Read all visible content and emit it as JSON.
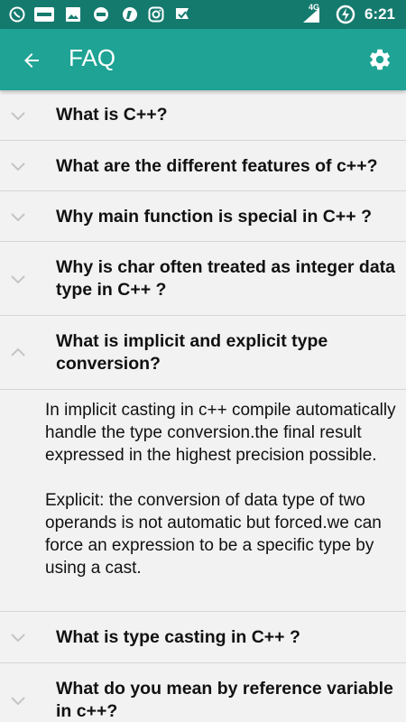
{
  "status_bar": {
    "left_icons": [
      "whatsapp-icon",
      "paytm-icon",
      "image-icon",
      "jio-icon",
      "app-icon",
      "instagram-icon",
      "checklist-icon"
    ],
    "network": "4G",
    "time": "6:21"
  },
  "app_bar": {
    "back_icon": "arrow-left-icon",
    "title": "FAQ",
    "settings_icon": "gear-icon"
  },
  "faq": [
    {
      "question": "What is C++?",
      "expanded": false
    },
    {
      "question": "What are the different features of c++?",
      "expanded": false
    },
    {
      "question": "Why main function is special in C++ ?",
      "expanded": false
    },
    {
      "question": "Why is char often treated as integer data type in C++ ?",
      "expanded": false
    },
    {
      "question": "What is implicit and explicit type conversion?",
      "expanded": true,
      "answer": [
        "In implicit casting in c++ compile automatically handle the type conversion.the final result expressed in the highest precision possible.",
        "Explicit: the conversion of data type of two operands is not automatic but forced.we can force an expression to be a specific type by using a cast."
      ]
    },
    {
      "question": "What is type casting in C++ ?",
      "expanded": false
    },
    {
      "question": "What do you mean by reference variable in c++?",
      "expanded": false
    }
  ],
  "colors": {
    "status_bar": "#157a6e",
    "app_bar": "#1ea394",
    "background": "#f2f2f2",
    "divider": "#d6d6d6",
    "chevron": "#c4c4c4"
  }
}
